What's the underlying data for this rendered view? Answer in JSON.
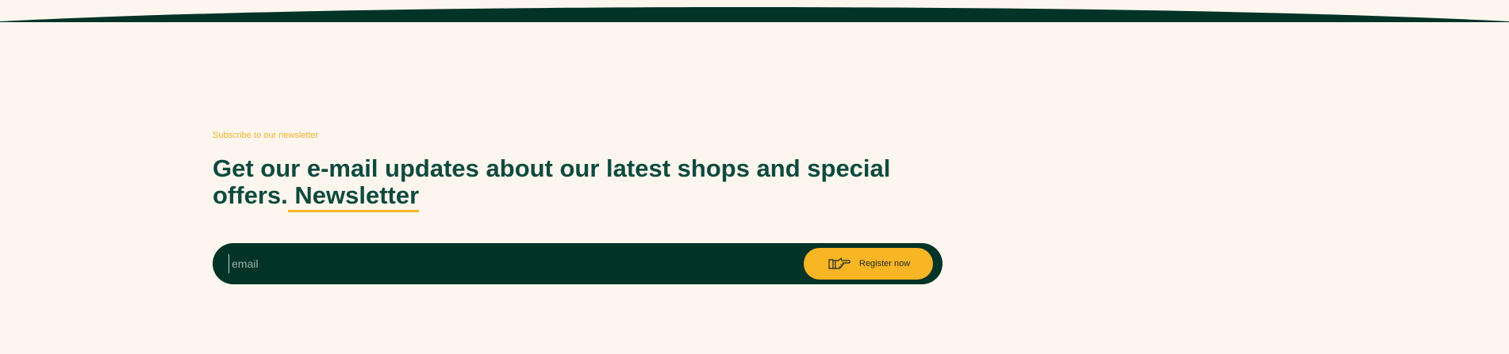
{
  "newsletter": {
    "eyebrow": "Subscribe to our newsletter",
    "headline_main": "Get our e-mail updates about our latest shops and special offers.",
    "headline_accent": " Newsletter"
  },
  "form": {
    "email_placeholder": "email",
    "register_label": "Register now"
  },
  "icons": {
    "register": "pointing-hand-icon"
  },
  "colors": {
    "background": "#fdf6ee",
    "dark_green": "#023327",
    "heading_green": "#0e4a3e",
    "accent_yellow": "#f8b524"
  }
}
